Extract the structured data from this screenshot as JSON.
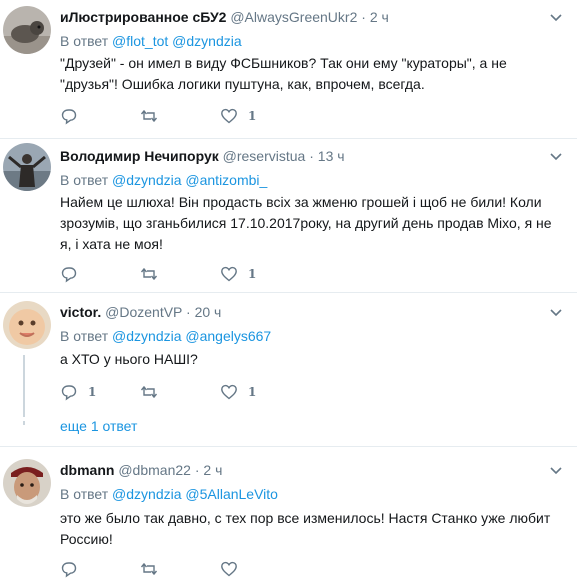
{
  "tweets": [
    {
      "name": "иЛюстрированное сБУ2",
      "handle": "@AlwaysGreenUkr2",
      "time": "2 ч",
      "reply_prefix": "В ответ",
      "reply_to": [
        "@flot_tot",
        "@dzyndzia"
      ],
      "text": "\"Друзей\" - он имел в виду ФСБшников? Так они ему \"кураторы\", а не \"друзья\"! Ошибка логики пуштуна, как, впрочем, всегда.",
      "replies": "",
      "retweets": "",
      "likes": "1"
    },
    {
      "name": "Володимир Нечипорук",
      "handle": "@reservistua",
      "time": "13 ч",
      "reply_prefix": "В ответ",
      "reply_to": [
        "@dzyndzia",
        "@antizombi_"
      ],
      "text": "Найем це шлюха! Він продасть всіх за жменю грошей і щоб не били! Коли зрозумів, що зганьбилися 17.10.2017року, на другий день продав Міхо, я не я, і хата не моя!",
      "replies": "",
      "retweets": "",
      "likes": "1"
    },
    {
      "name": "victor.",
      "handle": "@DozentVP",
      "time": "20 ч",
      "reply_prefix": "В ответ",
      "reply_to": [
        "@dzyndzia",
        "@angelys667"
      ],
      "text": "а ХТО у нього НАШІ?",
      "replies": "1",
      "retweets": "",
      "likes": "1",
      "more_replies": "еще 1 ответ"
    },
    {
      "name": "dbmann",
      "handle": "@dbman22",
      "time": "2 ч",
      "reply_prefix": "В ответ",
      "reply_to": [
        "@dzyndzia",
        "@5AllanLeVito"
      ],
      "text": "это же было так давно, с тех пор все изменилось! Настя Станко уже любит Россию!",
      "replies": "",
      "retweets": "",
      "likes": ""
    }
  ],
  "icons": {
    "reply": "reply-icon",
    "retweet": "retweet-icon",
    "like": "heart-icon",
    "caret": "chevron-down-icon"
  },
  "colors": {
    "link": "#1b95e0",
    "muted": "#657786",
    "separator": "#e6ecf0",
    "thread_line": "#ccd6dd"
  }
}
